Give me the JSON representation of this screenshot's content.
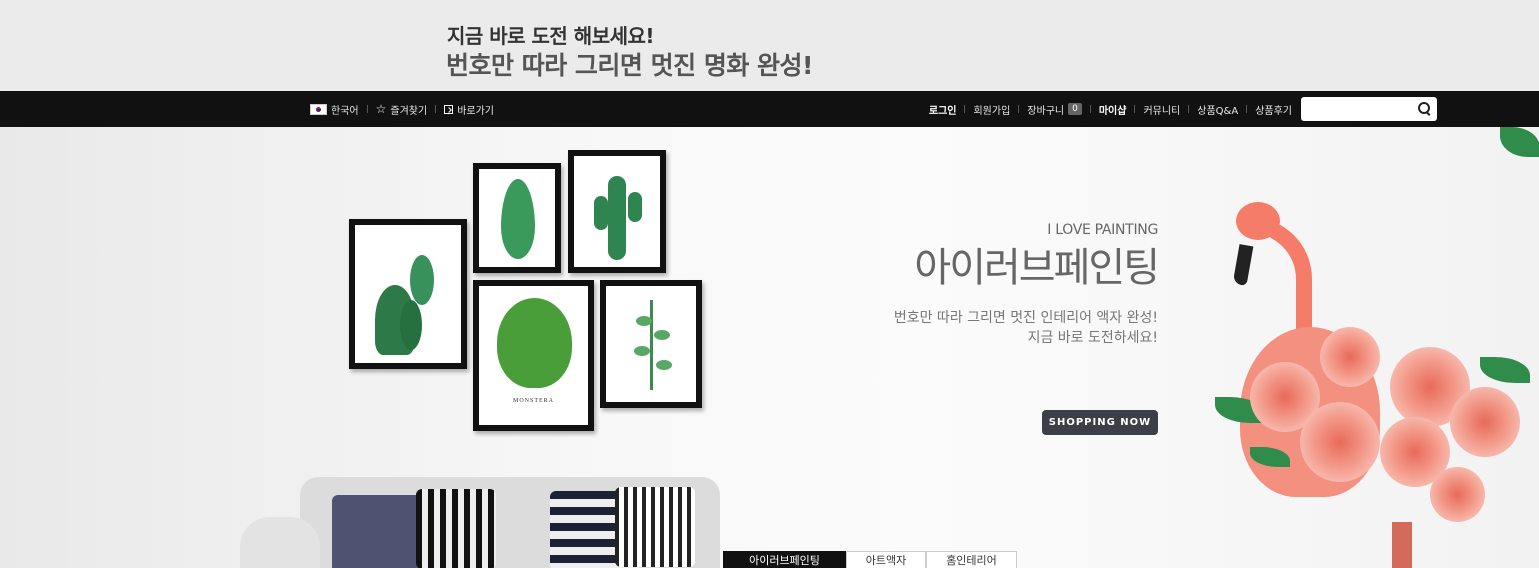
{
  "promo": {
    "line1": "지금 바로 도전 해보세요!",
    "line2": "번호만 따라 그리면 멋진 명화 완성!"
  },
  "nav": {
    "language": "한국어",
    "bookmark": "즐겨찾기",
    "shortcut": "바로가기",
    "login": "로그인",
    "signup": "회원가입",
    "cart": "장바구니",
    "cart_count": "0",
    "mypage": "마이샵",
    "community": "커뮤니티",
    "qna": "상품Q&A",
    "review": "상품후기",
    "search_placeholder": ""
  },
  "hero": {
    "subtitle": "I LOVE PAINTING",
    "title": "아이러브페인팅",
    "desc_line1": "번호만 따라 그리면 멋진 인테리어 액자 완성!",
    "desc_line2": "지금 바로 도전하세요!",
    "button": "SHOPPING NOW",
    "frame_caption": "MONSTERA"
  },
  "tabs": [
    "아이러브페인팅",
    "아트액자",
    "홈인테리어"
  ],
  "colors": {
    "nav_bg": "#111111",
    "button_bg": "#3d3f48",
    "accent_flamingo": "#f47c68"
  }
}
